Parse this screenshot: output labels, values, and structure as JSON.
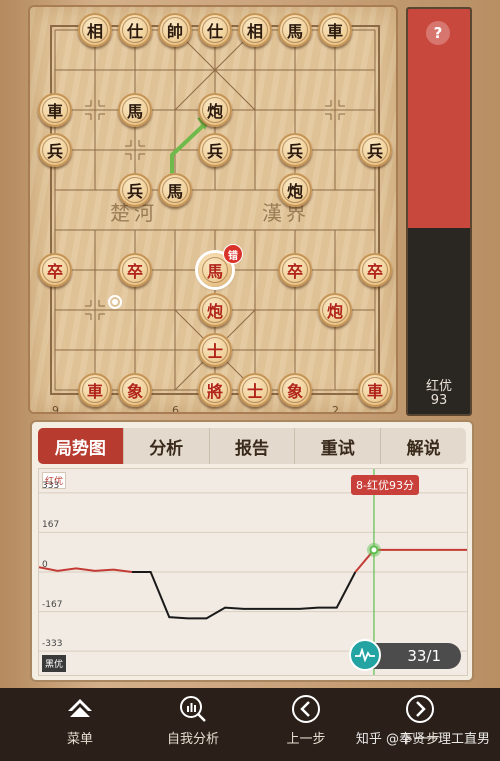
{
  "board": {
    "river_left": "楚河",
    "river_right": "漢界",
    "file_numbers": [
      {
        "label": "9",
        "file": 0
      },
      {
        "label": "6",
        "file": 3
      },
      {
        "label": "2",
        "file": 7
      }
    ],
    "pieces": [
      {
        "ch": "相",
        "color": "black",
        "file": 1,
        "rank": 0
      },
      {
        "ch": "仕",
        "color": "black",
        "file": 2,
        "rank": 0
      },
      {
        "ch": "帥",
        "color": "black",
        "file": 3,
        "rank": 0
      },
      {
        "ch": "仕",
        "color": "black",
        "file": 4,
        "rank": 0
      },
      {
        "ch": "相",
        "color": "black",
        "file": 5,
        "rank": 0
      },
      {
        "ch": "馬",
        "color": "black",
        "file": 6,
        "rank": 0
      },
      {
        "ch": "車",
        "color": "black",
        "file": 7,
        "rank": 0
      },
      {
        "ch": "車",
        "color": "black",
        "file": 0,
        "rank": 2
      },
      {
        "ch": "馬",
        "color": "black",
        "file": 2,
        "rank": 2
      },
      {
        "ch": "炮",
        "color": "black",
        "file": 4,
        "rank": 2
      },
      {
        "ch": "兵",
        "color": "black",
        "file": 0,
        "rank": 3
      },
      {
        "ch": "兵",
        "color": "black",
        "file": 4,
        "rank": 3
      },
      {
        "ch": "兵",
        "color": "black",
        "file": 6,
        "rank": 3
      },
      {
        "ch": "兵",
        "color": "black",
        "file": 8,
        "rank": 3
      },
      {
        "ch": "兵",
        "color": "black",
        "file": 2,
        "rank": 4
      },
      {
        "ch": "馬",
        "color": "black",
        "file": 3,
        "rank": 4
      },
      {
        "ch": "炮",
        "color": "black",
        "file": 6,
        "rank": 4
      },
      {
        "ch": "卒",
        "color": "red",
        "file": 0,
        "rank": 6
      },
      {
        "ch": "卒",
        "color": "red",
        "file": 2,
        "rank": 6
      },
      {
        "ch": "馬",
        "color": "red",
        "file": 4,
        "rank": 6,
        "selected": true,
        "badge": "错"
      },
      {
        "ch": "卒",
        "color": "red",
        "file": 6,
        "rank": 6
      },
      {
        "ch": "卒",
        "color": "red",
        "file": 8,
        "rank": 6
      },
      {
        "ch": "炮",
        "color": "red",
        "file": 4,
        "rank": 7
      },
      {
        "ch": "炮",
        "color": "red",
        "file": 7,
        "rank": 7
      },
      {
        "ch": "士",
        "color": "red",
        "file": 4,
        "rank": 8
      },
      {
        "ch": "車",
        "color": "red",
        "file": 1,
        "rank": 9
      },
      {
        "ch": "象",
        "color": "red",
        "file": 2,
        "rank": 9
      },
      {
        "ch": "將",
        "color": "red",
        "file": 4,
        "rank": 9
      },
      {
        "ch": "士",
        "color": "red",
        "file": 5,
        "rank": 9
      },
      {
        "ch": "象",
        "color": "red",
        "file": 6,
        "rank": 9
      },
      {
        "ch": "車",
        "color": "red",
        "file": 8,
        "rank": 9
      }
    ]
  },
  "eval_bar": {
    "help_symbol": "?",
    "label": "红优",
    "score": "93",
    "red_share": 0.54
  },
  "analysis": {
    "tabs": [
      {
        "label": "局势图",
        "active": true
      },
      {
        "label": "分析",
        "active": false
      },
      {
        "label": "报告",
        "active": false
      },
      {
        "label": "重试",
        "active": false
      },
      {
        "label": "解说",
        "active": false
      }
    ],
    "top_tag": "红优",
    "bottom_tag": "黑优",
    "y_ticks": [
      "333",
      "167",
      "0",
      "-167",
      "-333"
    ],
    "bubble": "8-红优93分",
    "counter": "33/1"
  },
  "chart_data": {
    "type": "line",
    "ylim": [
      -400,
      400
    ],
    "yticks": [
      333,
      167,
      0,
      -167,
      -333
    ],
    "x": [
      0,
      1,
      2,
      3,
      4,
      5,
      6,
      7,
      8,
      9,
      10,
      11,
      12,
      13,
      14,
      15,
      16,
      17,
      18,
      19,
      20,
      21,
      22,
      23
    ],
    "series": [
      {
        "color": "#c43b35",
        "values": [
          20,
          5,
          15,
          5,
          10,
          0,
          null,
          null,
          null,
          null,
          null,
          null,
          null,
          null,
          null,
          null,
          null,
          0,
          93,
          93,
          93,
          93,
          93,
          93
        ]
      },
      {
        "color": "#1a1a1a",
        "values": [
          null,
          null,
          null,
          null,
          null,
          0,
          0,
          -190,
          -195,
          -195,
          -150,
          -155,
          -155,
          -155,
          -155,
          -150,
          -150,
          0,
          null,
          null,
          null,
          null,
          null,
          null
        ]
      }
    ],
    "current_x": 18
  },
  "nav": {
    "items": [
      {
        "label": "菜单",
        "icon": "menu-icon"
      },
      {
        "label": "自我分析",
        "icon": "analysis-icon"
      },
      {
        "label": "上一步",
        "icon": "prev-icon"
      },
      {
        "label": "下一步",
        "icon": "next-icon"
      }
    ],
    "watermark": "知乎 @奉贤一理工直男"
  }
}
